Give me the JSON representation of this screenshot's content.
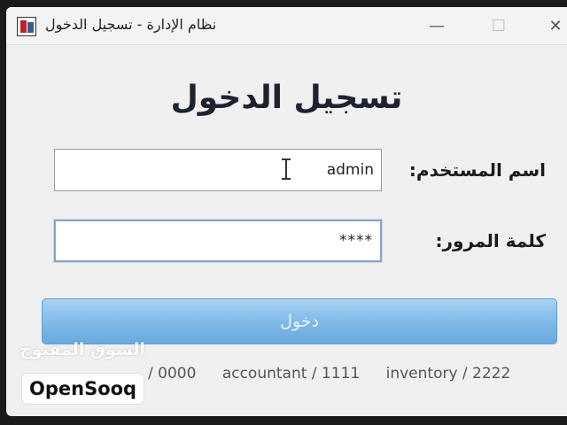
{
  "window": {
    "title": "نظام الإدارة - تسجيل الدخول",
    "minimize_glyph": "—",
    "maximize_glyph": "☐",
    "close_glyph": "✕"
  },
  "form": {
    "heading": "تسجيل الدخول",
    "username_label": "اسم المستخدم:",
    "username_value": "admin",
    "password_label": "كلمة المرور:",
    "password_value": "****",
    "login_button": "دخول"
  },
  "hints": {
    "partial": "/ 0000",
    "accountant": "accountant / 1111",
    "inventory": "inventory / 2222"
  },
  "watermark": {
    "arabic": "السوق المفتوح",
    "brand": "OpenSooq"
  },
  "colors": {
    "button_accent": "#7db8e6",
    "title_text": "#1e2230"
  }
}
